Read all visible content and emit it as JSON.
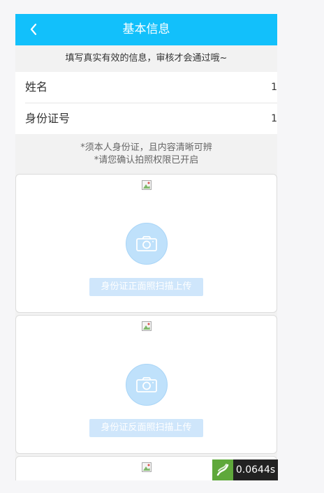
{
  "header": {
    "title": "基本信息",
    "back_icon": "chevron-left-icon"
  },
  "notice": "填写真实有效的信息，审核才会通过哦~",
  "form": {
    "fields": [
      {
        "label": "姓名",
        "value": "1"
      },
      {
        "label": "身份证号",
        "value": "1"
      }
    ]
  },
  "tips": {
    "line1": "*须本人身份证，且内容清晰可辨",
    "line2": "*请您确认拍照权限已开启"
  },
  "upload_cards": [
    {
      "button_label": "身份证正面照扫描上传",
      "icon": "camera-icon"
    },
    {
      "button_label": "身份证反面照扫描上传",
      "icon": "camera-icon"
    }
  ],
  "timer": {
    "value": "0.0644s"
  },
  "colors": {
    "header_bg": "#12c0fb",
    "camera_bg": "#bfe1fb",
    "button_bg": "#cfe6fb"
  }
}
